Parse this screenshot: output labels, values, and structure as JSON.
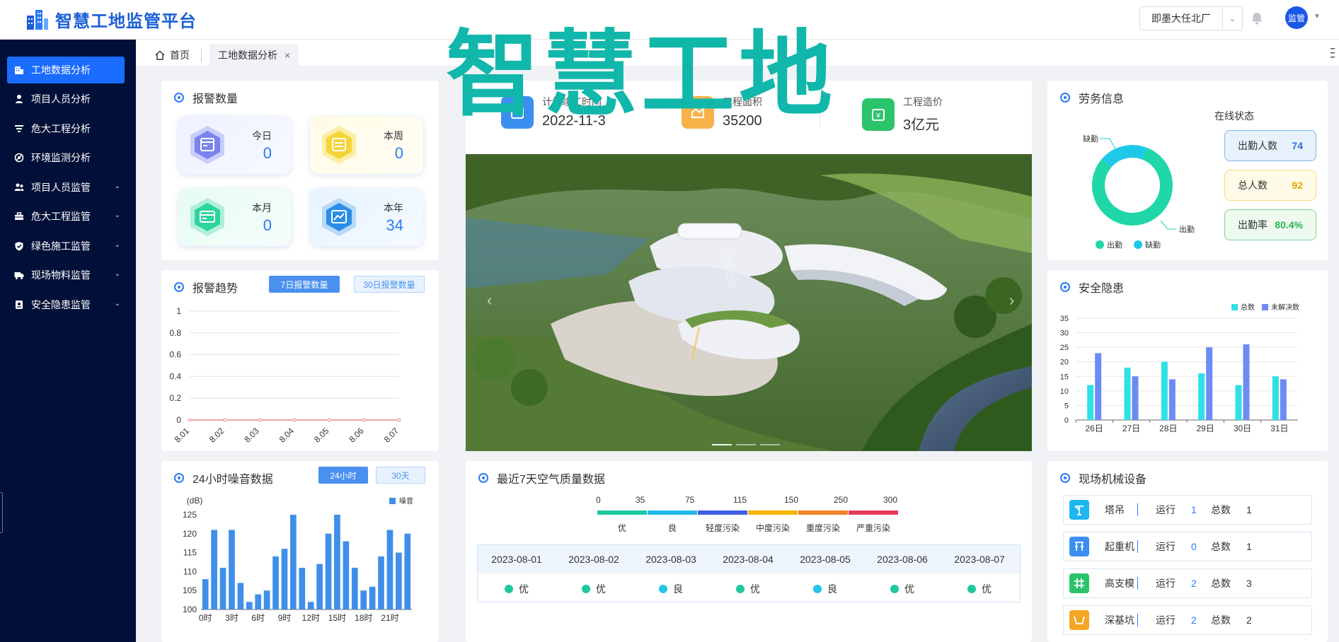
{
  "header": {
    "app_title": "智慧工地监管平台",
    "project_select": "即墨大任北厂",
    "avatar_text": "监管"
  },
  "sidebar": {
    "items": [
      {
        "label": "工地数据分析",
        "icon": "building-icon",
        "active": true,
        "expandable": false
      },
      {
        "label": "项目人员分析",
        "icon": "person-icon",
        "active": false,
        "expandable": false
      },
      {
        "label": "危大工程分析",
        "icon": "filter-icon",
        "active": false,
        "expandable": false
      },
      {
        "label": "环境监测分析",
        "icon": "sensor-icon",
        "active": false,
        "expandable": false
      },
      {
        "label": "项目人员监管",
        "icon": "people-icon",
        "active": false,
        "expandable": true
      },
      {
        "label": "危大工程监管",
        "icon": "toolbox-icon",
        "active": false,
        "expandable": true
      },
      {
        "label": "绿色施工监管",
        "icon": "shield-icon",
        "active": false,
        "expandable": true
      },
      {
        "label": "现场物料监管",
        "icon": "truck-icon",
        "active": false,
        "expandable": true
      },
      {
        "label": "安全隐患监管",
        "icon": "safety-icon",
        "active": false,
        "expandable": true
      }
    ]
  },
  "tabs": {
    "home": "首页",
    "active": "工地数据分析"
  },
  "alarm_count": {
    "title": "报警数量",
    "items": [
      {
        "label": "今日",
        "value": "0"
      },
      {
        "label": "本周",
        "value": "0"
      },
      {
        "label": "本月",
        "value": "0"
      },
      {
        "label": "本年",
        "value": "34"
      }
    ]
  },
  "alarm_trend": {
    "title": "报警趋势",
    "btn_7": "7日报警数量",
    "btn_30": "30日报警数量"
  },
  "noise": {
    "title": "24小时噪音数据",
    "btn_24": "24小时",
    "btn_30": "30天",
    "unit": "(dB)",
    "legend": "噪音"
  },
  "overview": {
    "overlay": "智慧工地",
    "stats": [
      {
        "label": "计划竣工时间",
        "value": "2022-11-3"
      },
      {
        "label": "工程面积",
        "value": "35200"
      },
      {
        "label": "工程造价",
        "value": "3亿元"
      }
    ]
  },
  "air_quality": {
    "title": "最近7天空气质量数据",
    "scale_numbers": [
      "0",
      "35",
      "75",
      "115",
      "150",
      "250",
      "300"
    ],
    "levels": [
      {
        "label": "优",
        "color": "#1cc8a0"
      },
      {
        "label": "良",
        "color": "#22b8e8"
      },
      {
        "label": "轻度污染",
        "color": "#3e5ee0"
      },
      {
        "label": "中度污染",
        "color": "#f5b400"
      },
      {
        "label": "重度污染",
        "color": "#f0822a"
      },
      {
        "label": "严重污染",
        "color": "#e83a5c"
      }
    ],
    "days": [
      {
        "date": "2023-08-01",
        "level": "优",
        "color": "#1cc8a0"
      },
      {
        "date": "2023-08-02",
        "level": "优",
        "color": "#1cc8a0"
      },
      {
        "date": "2023-08-03",
        "level": "良",
        "color": "#22c6e8"
      },
      {
        "date": "2023-08-04",
        "level": "优",
        "color": "#1cc8a0"
      },
      {
        "date": "2023-08-05",
        "level": "良",
        "color": "#22c6e8"
      },
      {
        "date": "2023-08-06",
        "level": "优",
        "color": "#1cc8a0"
      },
      {
        "date": "2023-08-07",
        "level": "优",
        "color": "#1cc8a0"
      }
    ]
  },
  "labor": {
    "title": "劳务信息",
    "online_status": "在线状态",
    "absent_label": "缺勤",
    "present_label": "出勤",
    "pills": [
      {
        "label": "出勤人数",
        "value": "74",
        "bg": "#e8f2fc",
        "border": "#7fb4ee",
        "color": "#2b6fd6"
      },
      {
        "label": "总人数",
        "value": "92",
        "bg": "#fffbe8",
        "border": "#f3dc86",
        "color": "#e0a800"
      },
      {
        "label": "出勤率",
        "value": "80.4%",
        "bg": "#eefaf0",
        "border": "#84d196",
        "color": "#2bb352"
      }
    ]
  },
  "safety": {
    "title": "安全隐患",
    "legend_total": "总数",
    "legend_unsolved": "未解决数"
  },
  "machinery": {
    "title": "现场机械设备",
    "run_label": "运行",
    "total_label": "总数",
    "items": [
      {
        "name": "塔吊",
        "run": "1",
        "total": "1",
        "color": "#1fb6f0",
        "icon": "tower-crane-icon"
      },
      {
        "name": "起重机",
        "run": "0",
        "total": "1",
        "color": "#3b8ff0",
        "icon": "crane-icon"
      },
      {
        "name": "高支模",
        "run": "2",
        "total": "3",
        "color": "#2bc46a",
        "icon": "formwork-icon"
      },
      {
        "name": "深基坑",
        "run": "2",
        "total": "2",
        "color": "#f5a623",
        "icon": "pit-icon"
      }
    ]
  },
  "chart_data": [
    {
      "type": "line",
      "categories": [
        "8.01",
        "8.02",
        "8.03",
        "8.04",
        "8.05",
        "8.06",
        "8.07"
      ],
      "series": [
        {
          "values": [
            0,
            0,
            0,
            0,
            0,
            0,
            0
          ]
        }
      ],
      "ylim": [
        0,
        1
      ],
      "yticks": [
        "0",
        "0.2",
        "0.4",
        "0.6",
        "0.8",
        "1"
      ],
      "color": "#e88a8a"
    },
    {
      "type": "bar",
      "categories": [
        "0时",
        "1时",
        "2时",
        "3时",
        "4时",
        "5时",
        "6时",
        "7时",
        "8时",
        "9时",
        "10时",
        "11时",
        "12时",
        "13时",
        "14时",
        "15时",
        "16时",
        "17时",
        "18时",
        "19时",
        "20时",
        "21时",
        "22时",
        "23时"
      ],
      "tick_labels": [
        "0时",
        "3时",
        "6时",
        "9时",
        "12时",
        "15时",
        "18时",
        "21时"
      ],
      "series": [
        {
          "name": "噪音",
          "values": [
            108,
            121,
            111,
            121,
            107,
            102,
            104,
            105,
            114,
            116,
            125,
            111,
            102,
            112,
            120,
            125,
            118,
            111,
            105,
            106,
            114,
            121,
            115,
            120
          ]
        }
      ],
      "ylabel": "(dB)",
      "ylim": [
        100,
        125
      ],
      "yticks": [
        "100",
        "105",
        "110",
        "115",
        "120",
        "125"
      ],
      "color": "#3f8fea"
    },
    {
      "type": "pie",
      "categories": [
        "出勤",
        "缺勤"
      ],
      "values": [
        74,
        18
      ],
      "colors": [
        "#1fd7a8",
        "#1ec8e8"
      ]
    },
    {
      "type": "bar",
      "categories": [
        "26日",
        "27日",
        "28日",
        "29日",
        "30日",
        "31日"
      ],
      "series": [
        {
          "name": "总数",
          "values": [
            12,
            18,
            20,
            16,
            12,
            15
          ],
          "color": "#2fe0e6"
        },
        {
          "name": "未解决数",
          "values": [
            23,
            15,
            14,
            25,
            26,
            14
          ],
          "color": "#6d8bf5"
        }
      ],
      "ylim": [
        0,
        35
      ],
      "yticks": [
        "0",
        "5",
        "10",
        "15",
        "20",
        "25",
        "30",
        "35"
      ]
    }
  ]
}
